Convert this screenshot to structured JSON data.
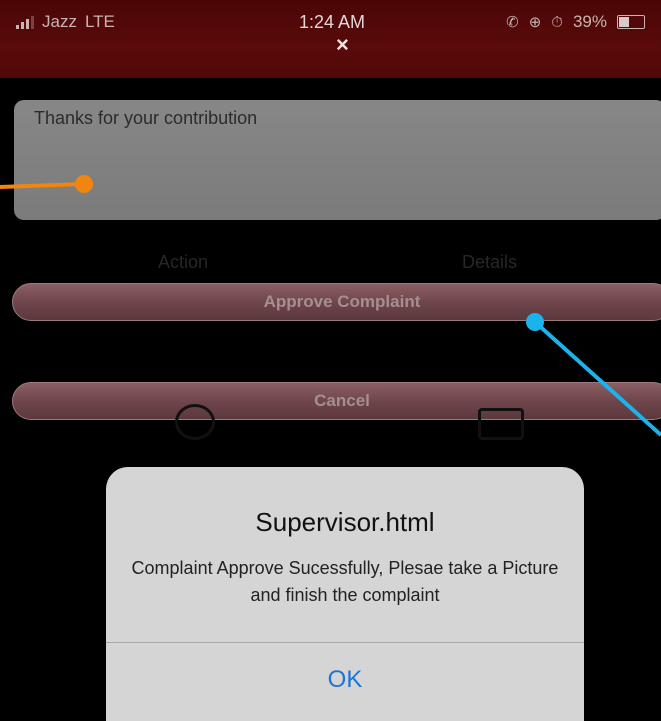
{
  "status_bar": {
    "carrier": "Jazz",
    "network": "LTE",
    "time": "1:24 AM",
    "close_glyph": "×",
    "battery_percent": "39%",
    "battery_level": 0.39
  },
  "form": {
    "message_text": "Thanks for your contribution",
    "tabs": [
      {
        "label": "Action"
      },
      {
        "label": "Details"
      }
    ],
    "approve_label": "Approve Complaint",
    "cancel_label": "Cancel"
  },
  "alert": {
    "title": "Supervisor.html",
    "message": "Complaint Approve Sucessfully, Plesae take a Picture and finish the complaint",
    "ok_label": "OK"
  },
  "annotations": {
    "orange_color": "#f0850f",
    "blue_color": "#1ab3ec"
  }
}
